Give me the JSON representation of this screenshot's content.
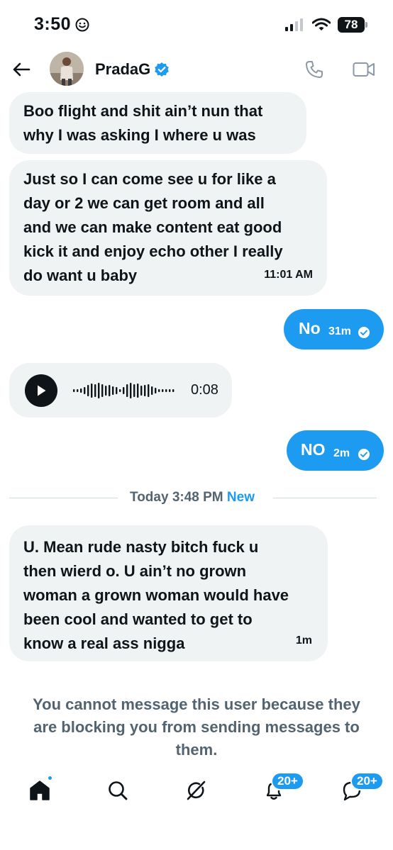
{
  "status_bar": {
    "time": "3:50",
    "battery": "78"
  },
  "header": {
    "user_name": "PradaG"
  },
  "messages": [
    {
      "text": "Boo flight and shit ain’t nun that\nwhy I was asking I where u was"
    },
    {
      "text": "Just so I can come see u for like a\nday or 2 we can get room and all\nand we can make content eat good\nkick it and enjoy echo other I really\ndo want u baby",
      "time": "11:01 AM"
    },
    {
      "text": "No",
      "time": "31m"
    },
    {
      "duration": "0:08"
    },
    {
      "text": "NO",
      "time": "2m"
    },
    {
      "text": "U. Mean rude nasty bitch fuck u\nthen wierd o.  U ain’t no grown\nwoman a grown woman would have\nbeen cool and wanted to get to\nknow a real ass nigga",
      "time": "1m"
    }
  ],
  "divider": {
    "label": "Today 3:48 PM",
    "new_label": "New"
  },
  "blocked_notice": "You cannot message this user because they are blocking you from sending messages to them.",
  "bottom_nav": {
    "notifications_badge": "20+",
    "messages_badge": "20+"
  },
  "colors": {
    "accent": "#1d9bf0",
    "bubble_in": "#eff3f4",
    "text": "#0f1419",
    "muted": "#536471"
  }
}
